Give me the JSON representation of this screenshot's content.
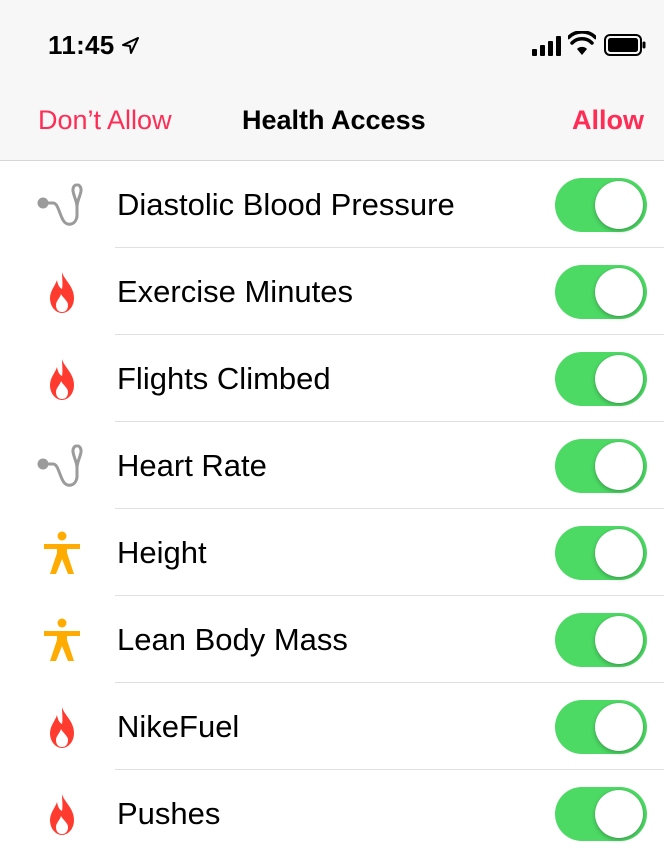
{
  "status_bar": {
    "time": "11:45",
    "location_icon": "location-arrow-icon",
    "signal_icon": "cellular-signal-icon",
    "wifi_icon": "wifi-icon",
    "battery_icon": "battery-icon"
  },
  "nav": {
    "left_label": "Don’t Allow",
    "title": "Health Access",
    "right_label": "Allow"
  },
  "colors": {
    "accent": "#ff2d55",
    "toggle_on": "#4cd964",
    "vitals": "#9b9b9b",
    "activity": "#ff3b30",
    "body": "#ffab00"
  },
  "items": [
    {
      "label": "Diastolic Blood Pressure",
      "icon": "stethoscope-icon",
      "enabled": true
    },
    {
      "label": "Exercise Minutes",
      "icon": "flame-icon",
      "enabled": true
    },
    {
      "label": "Flights Climbed",
      "icon": "flame-icon",
      "enabled": true
    },
    {
      "label": "Heart Rate",
      "icon": "stethoscope-icon",
      "enabled": true
    },
    {
      "label": "Height",
      "icon": "body-figure-icon",
      "enabled": true
    },
    {
      "label": "Lean Body Mass",
      "icon": "body-figure-icon",
      "enabled": true
    },
    {
      "label": "NikeFuel",
      "icon": "flame-icon",
      "enabled": true
    },
    {
      "label": "Pushes",
      "icon": "flame-icon",
      "enabled": true
    }
  ]
}
